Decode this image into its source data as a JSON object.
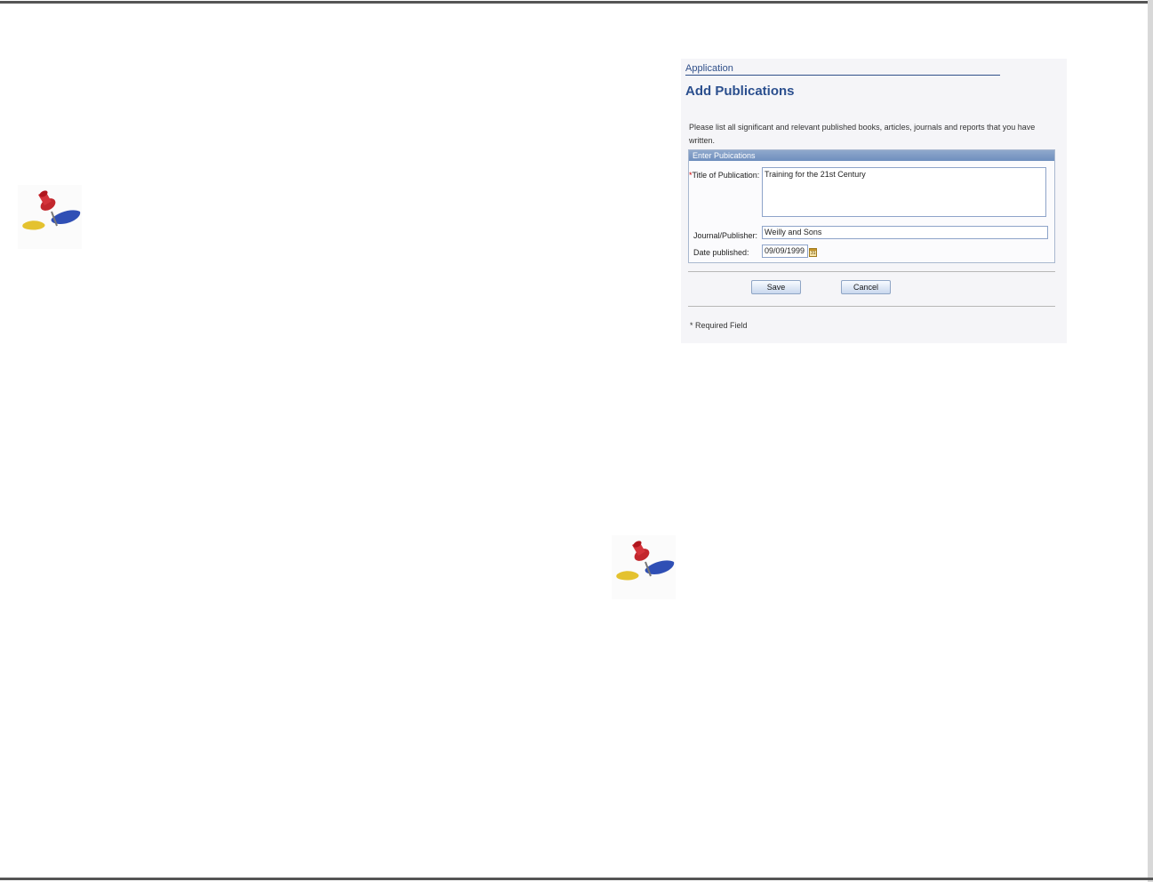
{
  "icons": {
    "pushpin": "pushpin-icon",
    "calendar": "calendar-icon"
  },
  "colors": {
    "accent": "#2b4f8e",
    "group_header": "#7b97c3",
    "pin_red": "#c2272d",
    "pin_blue": "#2f4fb5",
    "pin_yellow": "#e4c22f"
  },
  "screen": {
    "app_label": "Application",
    "title": "Add Publications",
    "intro": "Please list all significant and relevant published books, articles, journals and reports that you have written.",
    "group": {
      "header": "Enter Pubications",
      "fields": {
        "title_required_mark": "*",
        "title_label": "Title of Publication:",
        "title_value": "Training for the 21st Century",
        "journal_label": "Journal/Publisher:",
        "journal_value": "Weilly and Sons",
        "date_label": "Date published:",
        "date_value": "09/09/1999",
        "calendar_glyph": "31"
      }
    },
    "buttons": {
      "save": "Save",
      "cancel": "Cancel"
    },
    "required_note": "* Required Field"
  }
}
